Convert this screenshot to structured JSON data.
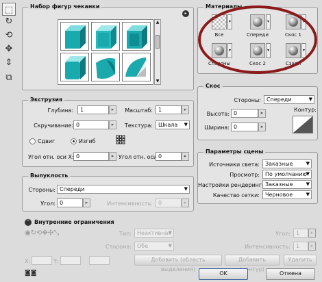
{
  "toolbar": {
    "tools": [
      "select-tool-icon",
      "rotate-tool-icon",
      "roll-tool-icon",
      "drag-tool-icon",
      "slide-tool-icon",
      "scale-tool-icon",
      "camera-icon"
    ]
  },
  "shapes_panel": {
    "title": "Набор фигур чеканки",
    "menu_glyph": "▸"
  },
  "extrusion": {
    "title": "Экструзия",
    "depth_label": "Глубина:",
    "depth_value": "1",
    "scale_label": "Масштаб:",
    "scale_value": "1",
    "twist_label": "Скручивание:",
    "twist_value": "0",
    "texture_label": "Текстура:",
    "texture_value": "Шкала",
    "shear_label": "Сдвиг",
    "bend_label": "Изгиб",
    "angle_x_label": "Угол отн. оси X:",
    "angle_x_value": "0",
    "angle_y_label": "Угол отн. оси Y:",
    "angle_y_value": "0"
  },
  "inflation": {
    "title": "Выпуклость",
    "sides_label": "Стороны:",
    "sides_value": "Спереди",
    "angle_label": "Угол:",
    "angle_value": "0",
    "intensity_label": "Интенсивность:",
    "intensity_value": "0"
  },
  "constraints": {
    "title": "Внутренние ограничения",
    "type_label": "Тип:",
    "type_value": "Неактивная",
    "side_label": "Сторона:",
    "side_value": "Обе",
    "angle_label": "Угол:",
    "angle_value": "1",
    "intensity_label": "Интенсивность:",
    "intensity_value": "1",
    "x_label": "X:",
    "y_label": "Y:",
    "add_selection_label": "Добавить (область выделения)",
    "add_path_label": "Добавить (контур)",
    "delete_label": "Удалить"
  },
  "materials": {
    "title": "Материалы",
    "items": [
      "Все",
      "Спереди",
      "Скос 1",
      "Стороны",
      "Скос 2",
      "Сзади"
    ]
  },
  "bevel": {
    "title": "Скос",
    "sides_label": "Стороны:",
    "sides_value": "Спереди",
    "height_label": "Высота:",
    "height_value": "0",
    "contour_label": "Контур:",
    "width_label": "Ширина:",
    "width_value": "0"
  },
  "scene": {
    "title": "Параметры сцены",
    "light_label": "Источники света:",
    "light_value": "Заказные",
    "view_label": "Просмотр:",
    "view_value": "По умолчанию",
    "render_label": "Настройки рендеринга:",
    "render_value": "Заказные",
    "mesh_label": "Качество сетки:",
    "mesh_value": "Черновое"
  },
  "dialog": {
    "ok_label": "OK",
    "cancel_label": "Отмена"
  },
  "colors": {
    "highlight_ring": "#8b1a1a",
    "shape_teal": "#1aa9ad"
  }
}
